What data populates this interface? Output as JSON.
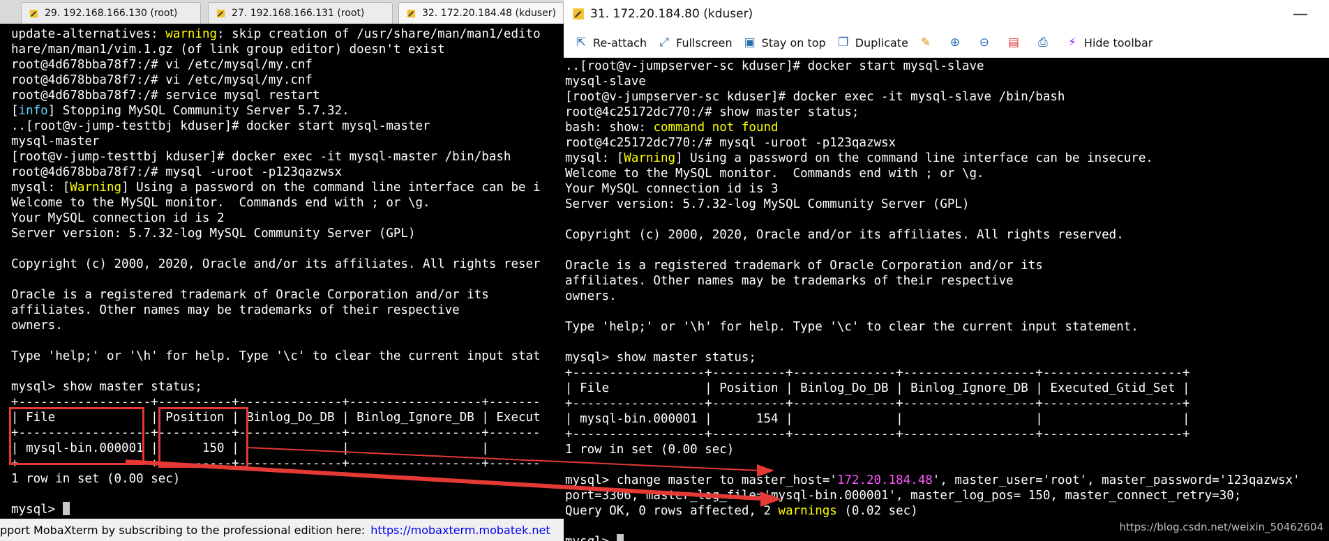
{
  "left": {
    "tabs": [
      {
        "label": "29. 192.168.166.130 (root)"
      },
      {
        "label": "27. 192.168.166.131 (root)"
      },
      {
        "label": "32. 172.20.184.48 (kduser)"
      }
    ],
    "lines": [
      {
        "parts": [
          {
            "t": "update-alternatives: "
          },
          {
            "t": "warning",
            "c": "y"
          },
          {
            "t": ": skip creation of /usr/share/man/man1/edito"
          }
        ]
      },
      {
        "parts": [
          {
            "t": "hare/man/man1/vim.1.gz (of link group editor) doesn't exist"
          }
        ]
      },
      {
        "parts": [
          {
            "t": "root@4d678bba78f7:/# vi /etc/mysql/my.cnf"
          }
        ]
      },
      {
        "parts": [
          {
            "t": "root@4d678bba78f7:/# vi /etc/mysql/my.cnf"
          }
        ]
      },
      {
        "parts": [
          {
            "t": "root@4d678bba78f7:/# service mysql restart"
          }
        ]
      },
      {
        "parts": [
          {
            "t": "["
          },
          {
            "t": "info",
            "c": "c"
          },
          {
            "t": "] Stopping MySQL Community Server 5.7.32."
          }
        ]
      },
      {
        "parts": [
          {
            "t": "..[root@v-jump-testtbj kduser]# docker start mysql-master"
          }
        ]
      },
      {
        "parts": [
          {
            "t": "mysql-master"
          }
        ]
      },
      {
        "parts": [
          {
            "t": "[root@v-jump-testtbj kduser]# docker exec -it mysql-master /bin/bash"
          }
        ]
      },
      {
        "parts": [
          {
            "t": "root@4d678bba78f7:/# mysql -uroot -p123qazwsx"
          }
        ]
      },
      {
        "parts": [
          {
            "t": "mysql: ["
          },
          {
            "t": "Warning",
            "c": "y"
          },
          {
            "t": "] Using a password on the command line interface can be i"
          }
        ]
      },
      {
        "parts": [
          {
            "t": "Welcome to the MySQL monitor.  Commands end with ; or \\g."
          }
        ]
      },
      {
        "parts": [
          {
            "t": "Your MySQL connection id is 2"
          }
        ]
      },
      {
        "parts": [
          {
            "t": "Server version: 5.7.32-log MySQL Community Server (GPL)"
          }
        ]
      },
      {
        "parts": [
          {
            "t": ""
          }
        ]
      },
      {
        "parts": [
          {
            "t": "Copyright (c) 2000, 2020, Oracle and/or its affiliates. All rights reser"
          }
        ]
      },
      {
        "parts": [
          {
            "t": ""
          }
        ]
      },
      {
        "parts": [
          {
            "t": "Oracle is a registered trademark of Oracle Corporation and/or its"
          }
        ]
      },
      {
        "parts": [
          {
            "t": "affiliates. Other names may be trademarks of their respective"
          }
        ]
      },
      {
        "parts": [
          {
            "t": "owners."
          }
        ]
      },
      {
        "parts": [
          {
            "t": ""
          }
        ]
      },
      {
        "parts": [
          {
            "t": "Type 'help;' or '\\h' for help. Type '\\c' to clear the current input stat"
          }
        ]
      },
      {
        "parts": [
          {
            "t": ""
          }
        ]
      },
      {
        "parts": [
          {
            "t": "mysql> show master status;"
          }
        ]
      },
      {
        "parts": [
          {
            "t": "+------------------+----------+--------------+------------------+-------"
          }
        ]
      },
      {
        "parts": [
          {
            "t": "| File             | Position | Binlog_Do_DB | Binlog_Ignore_DB | Execut"
          }
        ]
      },
      {
        "parts": [
          {
            "t": "+------------------+----------+--------------+------------------+-------"
          }
        ]
      },
      {
        "parts": [
          {
            "t": "| mysql-bin.000001 |      150 |              |                  |"
          }
        ]
      },
      {
        "parts": [
          {
            "t": "+------------------+----------+--------------+------------------+-------"
          }
        ]
      },
      {
        "parts": [
          {
            "t": "1 row in set (0.00 sec)"
          }
        ]
      },
      {
        "parts": [
          {
            "t": ""
          }
        ]
      },
      {
        "parts": [
          {
            "t": "mysql> "
          }
        ],
        "cursor": true
      }
    ],
    "status_text": "pport MobaXterm by subscribing to the professional edition here:",
    "status_link": "https://mobaxterm.mobatek.net"
  },
  "right": {
    "title": "31. 172.20.184.80 (kduser)",
    "minimize": "—",
    "toolbar": [
      {
        "label": "Re-attach",
        "icon": "reattach-icon"
      },
      {
        "label": "Fullscreen",
        "icon": "fullscreen-icon"
      },
      {
        "label": "Stay on top",
        "icon": "stay-on-top-icon"
      },
      {
        "label": "Duplicate",
        "icon": "duplicate-icon"
      },
      {
        "label": "",
        "icon": "edit-icon"
      },
      {
        "label": "",
        "icon": "zoom-in-icon"
      },
      {
        "label": "",
        "icon": "zoom-out-icon"
      },
      {
        "label": "",
        "icon": "save-icon"
      },
      {
        "label": "",
        "icon": "print-icon"
      },
      {
        "label": "Hide toolbar",
        "icon": "hide-toolbar-icon"
      }
    ],
    "lines": [
      {
        "parts": [
          {
            "t": "..[root@v-jumpserver-sc kduser]# docker start mysql-slave"
          }
        ]
      },
      {
        "parts": [
          {
            "t": "mysql-slave"
          }
        ]
      },
      {
        "parts": [
          {
            "t": "[root@v-jumpserver-sc kduser]# docker exec -it mysql-slave /bin/bash"
          }
        ]
      },
      {
        "parts": [
          {
            "t": "root@4c25172dc770:/# show master status;"
          }
        ]
      },
      {
        "parts": [
          {
            "t": "bash: show: "
          },
          {
            "t": "command not found",
            "c": "y"
          }
        ]
      },
      {
        "parts": [
          {
            "t": "root@4c25172dc770:/# mysql -uroot -p123qazwsx"
          }
        ]
      },
      {
        "parts": [
          {
            "t": "mysql: ["
          },
          {
            "t": "Warning",
            "c": "y"
          },
          {
            "t": "] Using a password on the command line interface can be insecure."
          }
        ]
      },
      {
        "parts": [
          {
            "t": "Welcome to the MySQL monitor.  Commands end with ; or \\g."
          }
        ]
      },
      {
        "parts": [
          {
            "t": "Your MySQL connection id is 3"
          }
        ]
      },
      {
        "parts": [
          {
            "t": "Server version: 5.7.32-log MySQL Community Server (GPL)"
          }
        ]
      },
      {
        "parts": [
          {
            "t": ""
          }
        ]
      },
      {
        "parts": [
          {
            "t": "Copyright (c) 2000, 2020, Oracle and/or its affiliates. All rights reserved."
          }
        ]
      },
      {
        "parts": [
          {
            "t": ""
          }
        ]
      },
      {
        "parts": [
          {
            "t": "Oracle is a registered trademark of Oracle Corporation and/or its"
          }
        ]
      },
      {
        "parts": [
          {
            "t": "affiliates. Other names may be trademarks of their respective"
          }
        ]
      },
      {
        "parts": [
          {
            "t": "owners."
          }
        ]
      },
      {
        "parts": [
          {
            "t": ""
          }
        ]
      },
      {
        "parts": [
          {
            "t": "Type 'help;' or '\\h' for help. Type '\\c' to clear the current input statement."
          }
        ]
      },
      {
        "parts": [
          {
            "t": ""
          }
        ]
      },
      {
        "parts": [
          {
            "t": "mysql> show master status;"
          }
        ]
      },
      {
        "parts": [
          {
            "t": "+------------------+----------+--------------+------------------+-------------------+"
          }
        ]
      },
      {
        "parts": [
          {
            "t": "| File             | Position | Binlog_Do_DB | Binlog_Ignore_DB | Executed_Gtid_Set |"
          }
        ]
      },
      {
        "parts": [
          {
            "t": "+------------------+----------+--------------+------------------+-------------------+"
          }
        ]
      },
      {
        "parts": [
          {
            "t": "| mysql-bin.000001 |      154 |              |                  |                   |"
          }
        ]
      },
      {
        "parts": [
          {
            "t": "+------------------+----------+--------------+------------------+-------------------+"
          }
        ]
      },
      {
        "parts": [
          {
            "t": "1 row in set (0.00 sec)"
          }
        ]
      },
      {
        "parts": [
          {
            "t": ""
          }
        ]
      },
      {
        "parts": [
          {
            "t": "mysql> change master to master_host='"
          },
          {
            "t": "172.20.184.48",
            "c": "m"
          },
          {
            "t": "', master_user='root', master_password='123qazwsx'"
          }
        ]
      },
      {
        "parts": [
          {
            "t": "port=3306, master_log_file='mysql-bin.000001', master_log_pos= 150, master_connect_retry=30;"
          }
        ]
      },
      {
        "parts": [
          {
            "t": "Query OK, 0 rows affected, 2 "
          },
          {
            "t": "warnings",
            "c": "y"
          },
          {
            "t": " (0.02 sec)"
          }
        ]
      },
      {
        "parts": [
          {
            "t": ""
          }
        ]
      },
      {
        "parts": [
          {
            "t": "mysql> "
          }
        ],
        "cursor": true
      }
    ]
  },
  "watermark": "https://blog.csdn.net/weixin_50462604",
  "colors": {
    "annotation": "#e53935",
    "warning": "#ffff00",
    "info": "#5fd7ff",
    "host": "#ff55ff"
  }
}
